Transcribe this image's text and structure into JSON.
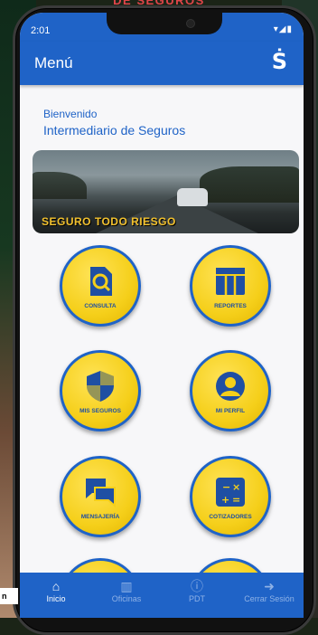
{
  "banner_text": "DE SEGUROS",
  "status": {
    "time": "2:01",
    "icons": "▾◢▮"
  },
  "appbar": {
    "title": "Menú",
    "logo_icon": "dollar-s-icon",
    "logo_glyph": "Ṡ"
  },
  "welcome": {
    "greeting": "Bienvenido",
    "user": "Intermediario de Seguros"
  },
  "promo": {
    "caption": "SEGURO TODO RIESGO"
  },
  "tiles": [
    {
      "label": "CONSULTA",
      "icon": "search-document-icon"
    },
    {
      "label": "REPORTES",
      "icon": "table-icon"
    },
    {
      "label": "MIS SEGUROS",
      "icon": "shield-icon"
    },
    {
      "label": "MI PERFIL",
      "icon": "user-icon"
    },
    {
      "label": "MENSAJERÍA",
      "icon": "chat-icon"
    },
    {
      "label": "COTIZADORES",
      "icon": "calculator-icon"
    }
  ],
  "nav": [
    {
      "label": "Inicio",
      "icon": "home-icon",
      "active": true
    },
    {
      "label": "Oficinas",
      "icon": "building-icon",
      "active": false
    },
    {
      "label": "PDT",
      "icon": "info-icon",
      "active": false
    },
    {
      "label": "Cerrar Sesión",
      "icon": "logout-icon",
      "active": false
    }
  ],
  "corner_label": "n",
  "colors": {
    "primary": "#1f63c7",
    "tile_yellow": "#f5cf1a",
    "caption_yellow": "#f2c12e"
  }
}
